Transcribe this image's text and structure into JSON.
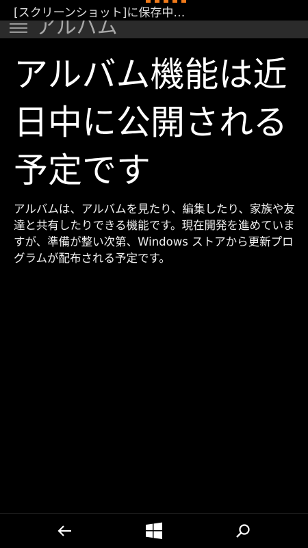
{
  "toast": {
    "text": "[スクリーンショット]に保存中…"
  },
  "header": {
    "title": "アルバム"
  },
  "main": {
    "headline": "アルバム機能は近日中に公開される予定です",
    "description": "アルバムは、アルバムを見たり、編集したり、家族や友達と共有したりできる機能です。現在開発を進めていますが、準備が整い次第、Windows ストアから更新プログラムが配布される予定です。"
  },
  "colors": {
    "background": "#000000",
    "header_band": "#2b2b2b",
    "indicator": "#f07a1a",
    "text": "#ffffff"
  },
  "nav": {
    "back_icon": "back-arrow-icon",
    "start_icon": "windows-start-icon",
    "search_icon": "search-icon"
  }
}
